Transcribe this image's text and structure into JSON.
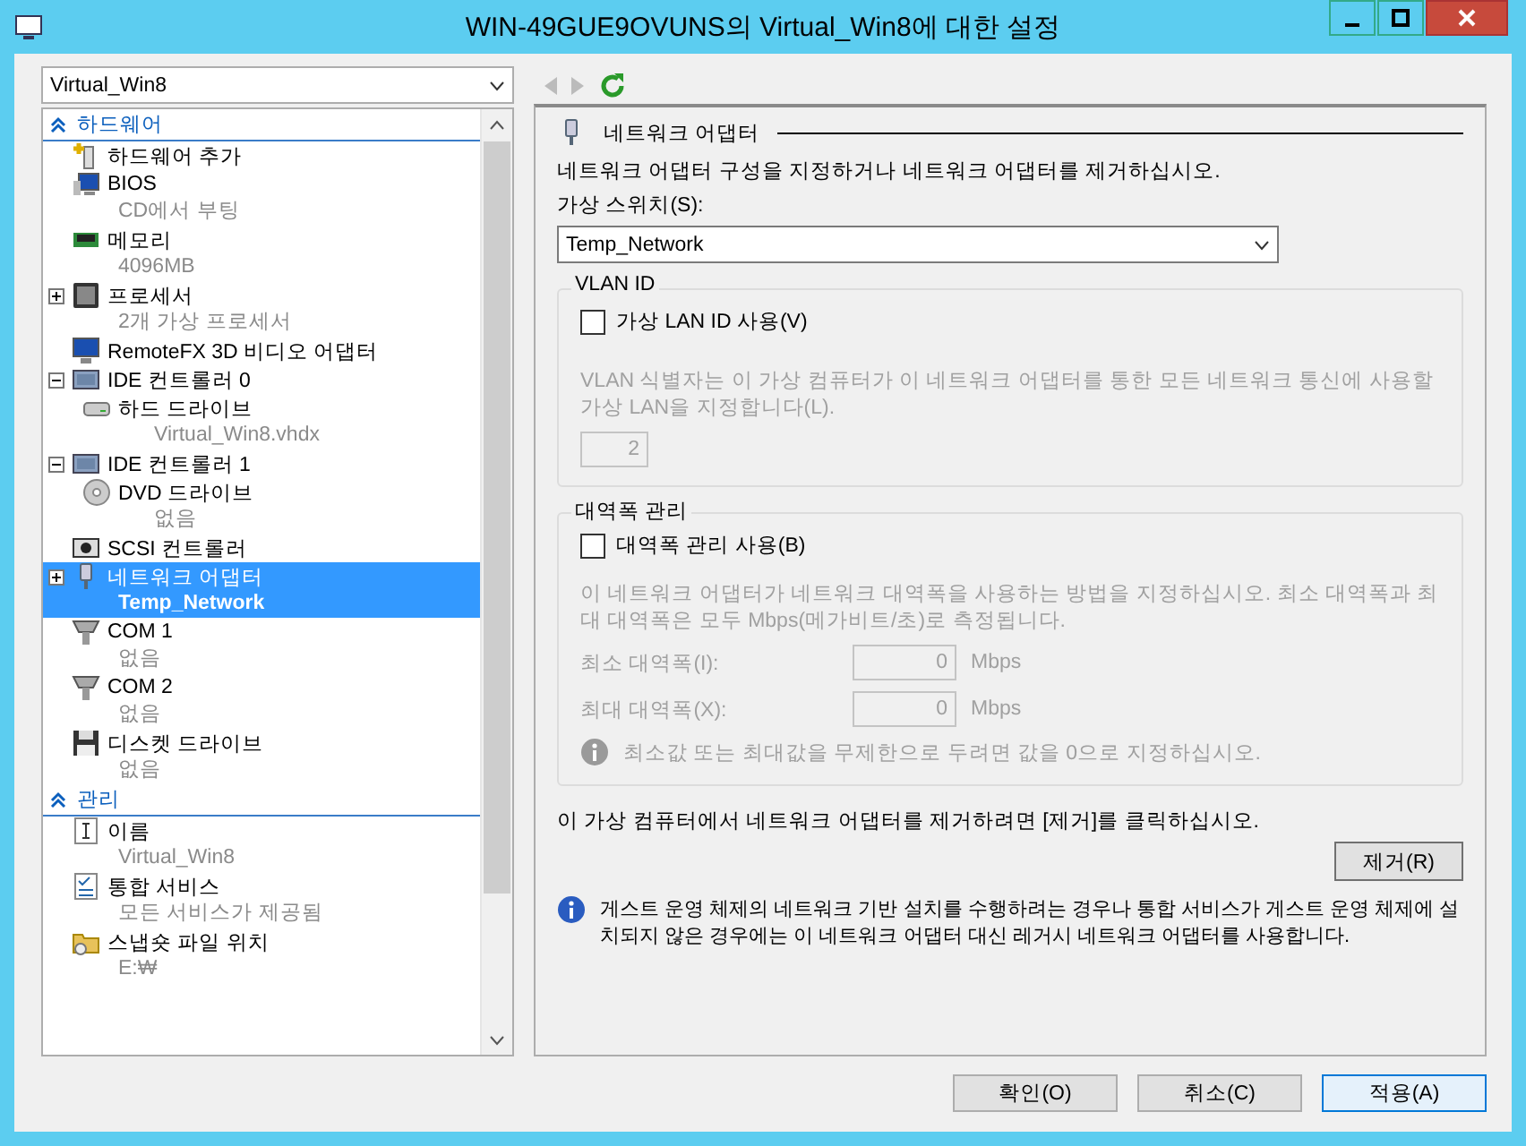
{
  "window": {
    "title": "WIN-49GUE9OVUNS의 Virtual_Win8에 대한 설정"
  },
  "vm_selector": {
    "value": "Virtual_Win8"
  },
  "nav": {
    "back_enabled": false,
    "forward_enabled": false
  },
  "tree": [
    {
      "section": "하드웨어",
      "expanded": true,
      "items": [
        {
          "kind": "add-hardware",
          "label": "하드웨어 추가",
          "selected": false
        },
        {
          "kind": "bios",
          "label": "BIOS",
          "detail": "CD에서 부팅",
          "selected": false
        },
        {
          "kind": "memory",
          "label": "메모리",
          "detail": "4096MB",
          "selected": false
        },
        {
          "kind": "cpu",
          "label": "프로세서",
          "detail": "2개 가상 프로세서",
          "expanded": false,
          "selected": false
        },
        {
          "kind": "monitor",
          "label": "RemoteFX 3D 비디오 어댑터",
          "selected": false
        },
        {
          "kind": "controller",
          "label": "IDE 컨트롤러 0",
          "expanded": true,
          "selected": false,
          "children": [
            {
              "kind": "disk",
              "label": "하드 드라이브",
              "detail": "Virtual_Win8.vhdx",
              "selected": false
            }
          ]
        },
        {
          "kind": "controller",
          "label": "IDE 컨트롤러 1",
          "expanded": true,
          "selected": false,
          "children": [
            {
              "kind": "dvd",
              "label": "DVD 드라이브",
              "detail": "없음",
              "selected": false
            }
          ]
        },
        {
          "kind": "scsi",
          "label": "SCSI 컨트롤러",
          "selected": false
        },
        {
          "kind": "network",
          "label": "네트워크 어댑터",
          "detail": "Temp_Network",
          "expanded": false,
          "selected": true
        },
        {
          "kind": "com",
          "label": "COM 1",
          "detail": "없음",
          "selected": false
        },
        {
          "kind": "com",
          "label": "COM 2",
          "detail": "없음",
          "selected": false
        },
        {
          "kind": "floppy",
          "label": "디스켓 드라이브",
          "detail": "없음",
          "selected": false
        }
      ]
    },
    {
      "section": "관리",
      "expanded": true,
      "items": [
        {
          "kind": "name",
          "label": "이름",
          "detail": "Virtual_Win8",
          "selected": false
        },
        {
          "kind": "services",
          "label": "통합 서비스",
          "detail": "모든 서비스가 제공됨",
          "selected": false
        },
        {
          "kind": "folder",
          "label": "스냅숏 파일 위치",
          "detail": "E:₩",
          "selected": false
        }
      ]
    }
  ],
  "panel": {
    "header": "네트워크 어댑터",
    "description": "네트워크 어댑터 구성을 지정하거나 네트워크 어댑터를 제거하십시오.",
    "switch_label": "가상 스위치(S):",
    "switch_value": "Temp_Network",
    "vlan": {
      "title": "VLAN ID",
      "checkbox_label": "가상 LAN ID 사용(V)",
      "checked": false,
      "enabled": false,
      "description": "VLAN 식별자는 이 가상 컴퓨터가 이 네트워크 어댑터를 통한 모든 네트워크 통신에 사용할 가상 LAN을 지정합니다(L).",
      "value": "2"
    },
    "bandwidth": {
      "title": "대역폭 관리",
      "checkbox_label": "대역폭 관리 사용(B)",
      "checked": false,
      "enabled": false,
      "description": "이 네트워크 어댑터가 네트워크 대역폭을 사용하는 방법을 지정하십시오. 최소 대역폭과 최대 대역폭은 모두 Mbps(메가비트/초)로 측정됩니다.",
      "fields": [
        {
          "label": "최소 대역폭(I):",
          "value": "0",
          "unit": "Mbps"
        },
        {
          "label": "최대 대역폭(X):",
          "value": "0",
          "unit": "Mbps"
        }
      ],
      "note": "최소값 또는 최대값을 무제한으로 두려면 값을 0으로 지정하십시오."
    },
    "remove_note": "이 가상 컴퓨터에서 네트워크 어댑터를 제거하려면 [제거]를 클릭하십시오.",
    "remove_button": "제거(R)",
    "info": "게스트 운영 체제의 네트워크 기반 설치를 수행하려는 경우나 통합 서비스가 게스트 운영 체제에 설치되지 않은 경우에는 이 네트워크 어댑터 대신 레거시 네트워크 어댑터를 사용합니다."
  },
  "buttons": [
    {
      "label": "확인(O)",
      "highlighted": false
    },
    {
      "label": "취소(C)",
      "highlighted": false
    },
    {
      "label": "적용(A)",
      "highlighted": true
    }
  ]
}
